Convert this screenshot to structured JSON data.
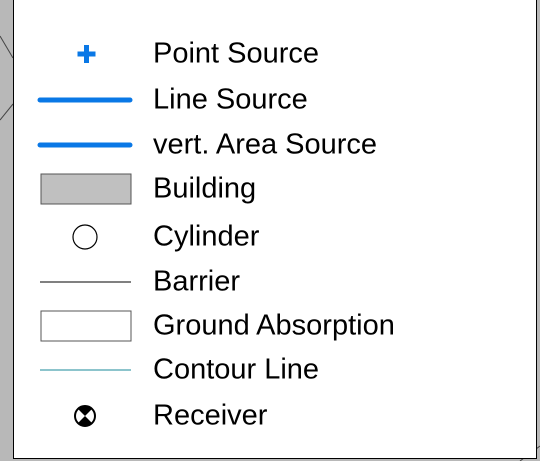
{
  "legend": {
    "items": [
      {
        "symbol": "point-source-icon",
        "label": "Point Source",
        "color": "#0a78e6"
      },
      {
        "symbol": "line-source-icon",
        "label": "Line Source",
        "color": "#0a78e6"
      },
      {
        "symbol": "vert-area-source-icon",
        "label": "vert. Area Source",
        "color": "#0a78e6"
      },
      {
        "symbol": "building-icon",
        "label": "Building",
        "color": "#c0c0c0"
      },
      {
        "symbol": "cylinder-icon",
        "label": "Cylinder",
        "color": "#ffffff"
      },
      {
        "symbol": "barrier-icon",
        "label": "Barrier",
        "color": "#000000"
      },
      {
        "symbol": "ground-absorption-icon",
        "label": "Ground Absorption",
        "color": "#ffffff"
      },
      {
        "symbol": "contour-line-icon",
        "label": "Contour Line",
        "color": "#1a8a9a"
      },
      {
        "symbol": "receiver-icon",
        "label": "Receiver",
        "color": "#000000"
      }
    ]
  },
  "colors": {
    "background": "#b8b8b8",
    "panel": "#ffffff",
    "source_blue": "#0a78e6",
    "building_gray": "#c0c0c0",
    "contour_teal": "#1a8a9a"
  }
}
